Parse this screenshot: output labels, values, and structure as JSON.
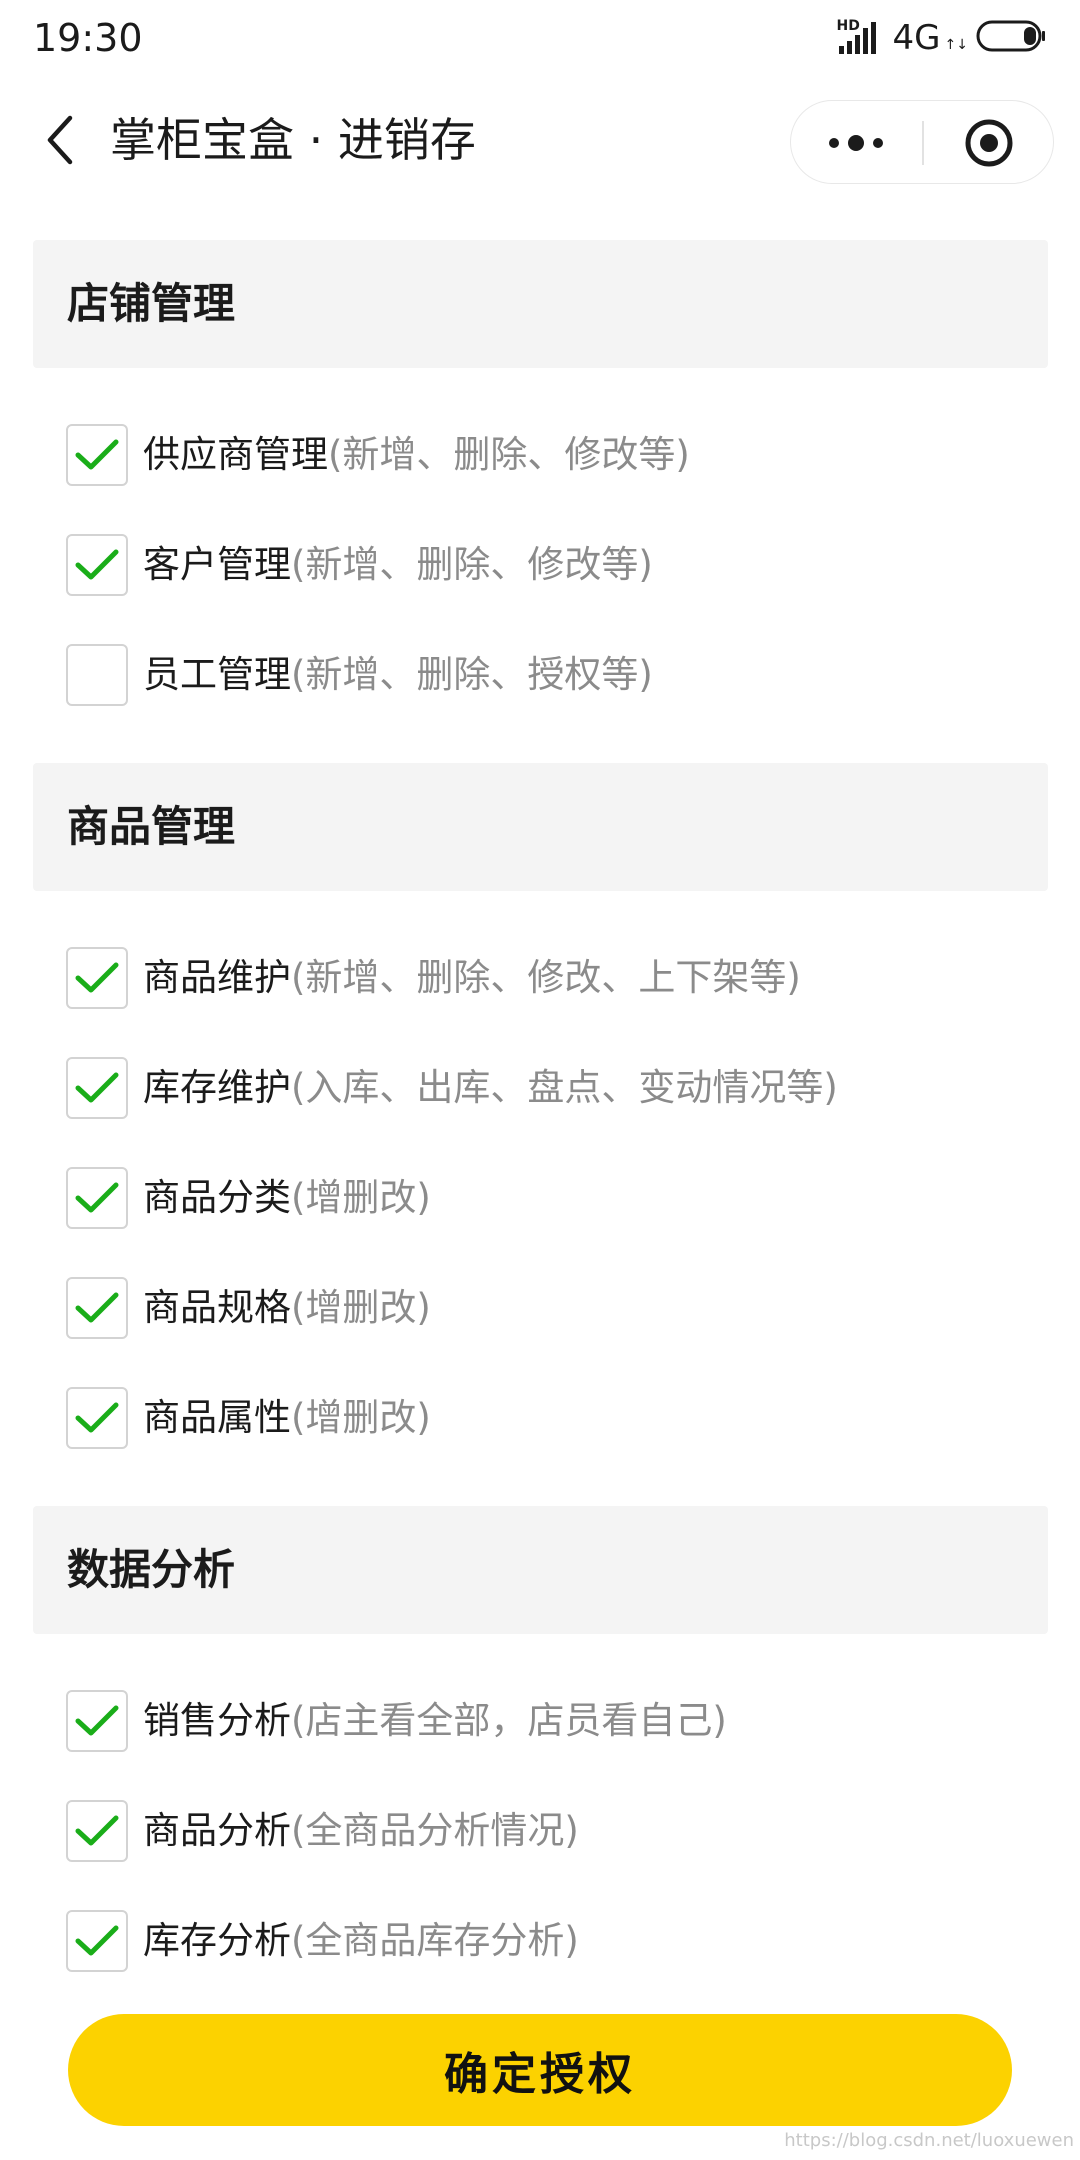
{
  "status_bar": {
    "time": "19:30",
    "hd": "HD",
    "network": "4G",
    "arrows": "↑↓"
  },
  "nav": {
    "title": "掌柜宝盒 · 进销存"
  },
  "colors": {
    "accent": "#fcd200",
    "check": "#1aad19",
    "section_bg": "#f4f4f4",
    "desc_text": "#8b8b8b"
  },
  "sections": [
    {
      "title": "店铺管理",
      "items": [
        {
          "label": "供应商管理",
          "desc": "(新增、删除、修改等)",
          "checked": true
        },
        {
          "label": "客户管理",
          "desc": "(新增、删除、修改等)",
          "checked": true
        },
        {
          "label": "员工管理",
          "desc": "(新增、删除、授权等)",
          "checked": false
        }
      ]
    },
    {
      "title": "商品管理",
      "items": [
        {
          "label": "商品维护",
          "desc": "(新增、删除、修改、上下架等)",
          "checked": true
        },
        {
          "label": "库存维护",
          "desc": "(入库、出库、盘点、变动情况等)",
          "checked": true
        },
        {
          "label": "商品分类",
          "desc": "(增删改)",
          "checked": true
        },
        {
          "label": "商品规格",
          "desc": "(增删改)",
          "checked": true
        },
        {
          "label": "商品属性",
          "desc": "(增删改)",
          "checked": true
        }
      ]
    },
    {
      "title": "数据分析",
      "items": [
        {
          "label": "销售分析",
          "desc": "(店主看全部，店员看自己)",
          "checked": true
        },
        {
          "label": "商品分析",
          "desc": "(全商品分析情况)",
          "checked": true
        },
        {
          "label": "库存分析",
          "desc": "(全商品库存分析)",
          "checked": true
        }
      ]
    }
  ],
  "confirm_button": {
    "label": "确定授权"
  },
  "watermark": "https://blog.csdn.net/luoxuewen"
}
